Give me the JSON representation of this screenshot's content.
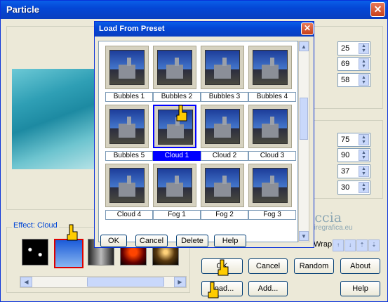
{
  "window": {
    "title": "Particle",
    "close_glyph": "✕"
  },
  "effect": {
    "legend": "Effect: Cloud"
  },
  "spinners_top": [
    "25",
    "69",
    "58"
  ],
  "spinners_mid": [
    "75",
    "90",
    "37",
    "30"
  ],
  "wrap_label": "Wrap",
  "buttons": {
    "ok": "OK",
    "cancel": "Cancel",
    "random": "Random",
    "about": "About",
    "load": "Load...",
    "add": "Add...",
    "help": "Help"
  },
  "dialog": {
    "title": "Load From Preset",
    "close_glyph": "✕",
    "presets": [
      {
        "label": "Bubbles 1"
      },
      {
        "label": "Bubbles 2"
      },
      {
        "label": "Bubbles 3"
      },
      {
        "label": "Bubbles 4"
      },
      {
        "label": "Bubbles 5"
      },
      {
        "label": "Cloud 1",
        "selected": true
      },
      {
        "label": "Cloud 2"
      },
      {
        "label": "Cloud 3"
      },
      {
        "label": "Cloud 4"
      },
      {
        "label": "Fog 1"
      },
      {
        "label": "Fog 2"
      },
      {
        "label": "Fog 3"
      }
    ],
    "buttons": {
      "ok": "OK",
      "cancel": "Cancel",
      "delete": "Delete",
      "help": "Help"
    }
  },
  "watermark": {
    "name": "Pinuccia",
    "url": "www.maidiregrafica.eu"
  },
  "colors": {
    "title_bar": "#0447d6",
    "selection": "#0000ff",
    "accent": "#0046d5"
  }
}
